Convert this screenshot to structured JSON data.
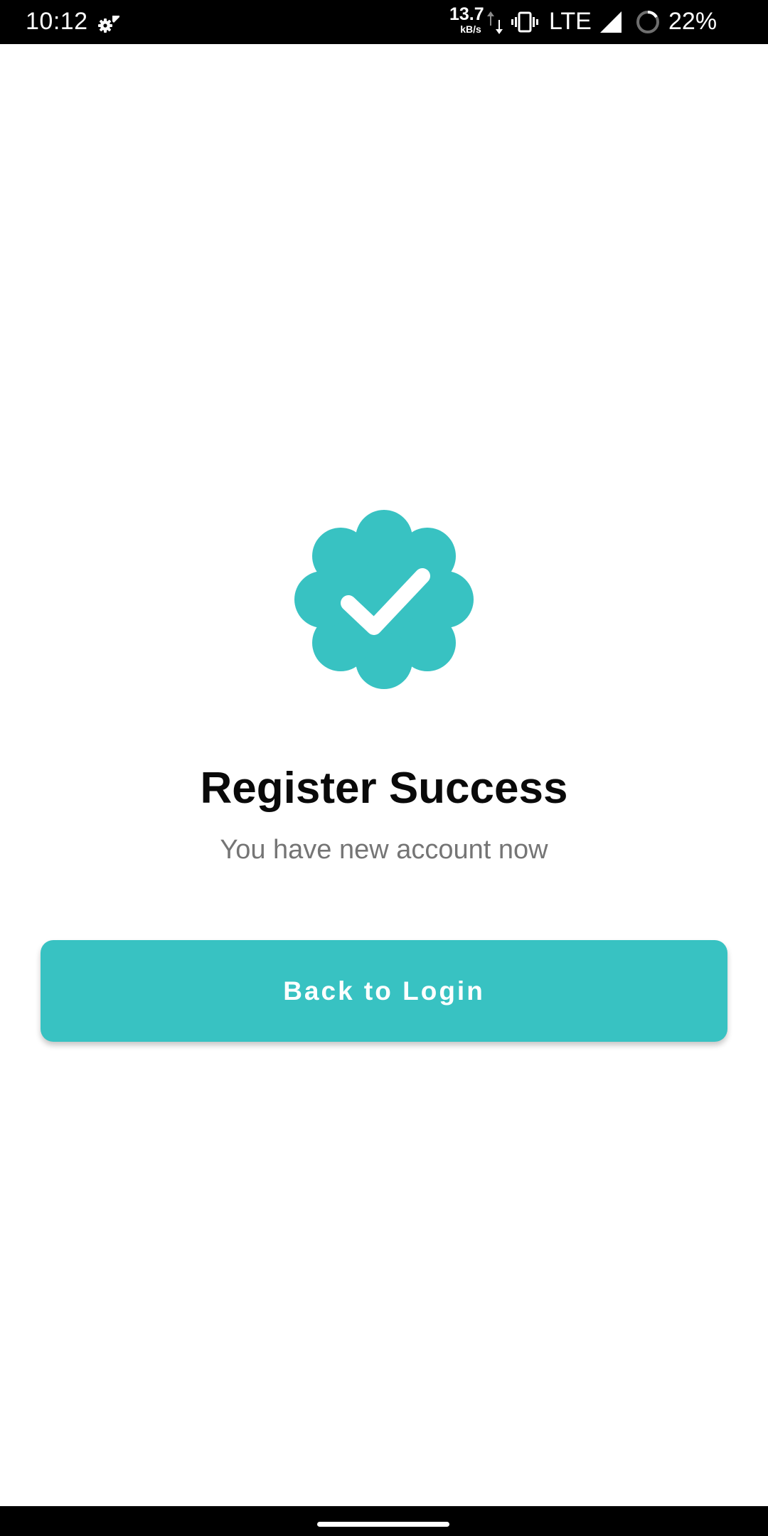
{
  "status_bar": {
    "time": "10:12",
    "network_speed": "13.7",
    "network_speed_unit": "kB/s",
    "network_type": "LTE",
    "battery_percent": "22%",
    "icons": [
      "settings-gear-icon",
      "data-transfer-arrows-icon",
      "vibrate-icon",
      "cell-signal-icon",
      "battery-saver-ring-icon"
    ]
  },
  "main": {
    "badge_icon": "verified-check-badge-icon",
    "title": "Register Success",
    "subtitle": "You have new account now",
    "button_label": "Back to Login"
  },
  "colors": {
    "accent": "#38c2c2",
    "title_text": "#0a0a0a",
    "subtitle_text": "#757575",
    "status_bar_bg": "#000000"
  }
}
